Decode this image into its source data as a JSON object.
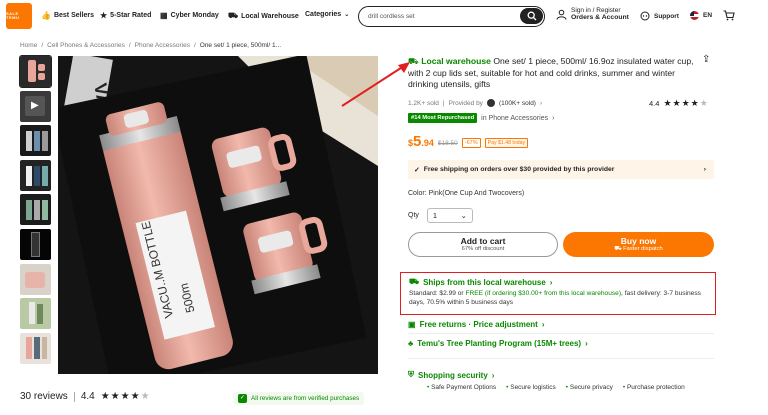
{
  "header": {
    "logo_line1": "SALE TEMU",
    "logo_line2": "TEMU",
    "nav": [
      {
        "label": "Best Sellers",
        "icon": "thumbs-up-icon"
      },
      {
        "label": "5-Star Rated",
        "icon": "star-icon"
      },
      {
        "label": "Cyber Monday",
        "icon": "calendar-icon"
      },
      {
        "label": "Local Warehouse",
        "icon": "truck-icon"
      },
      {
        "label": "Categories",
        "icon": "chevron-down-icon"
      }
    ],
    "search_value": "drill cordless set",
    "signin_line1": "Sign in / Register",
    "signin_line2": "Orders & Account",
    "support": "Support",
    "language": "EN"
  },
  "breadcrumb": [
    "Home",
    "Cell Phones & Accessories",
    "Phone Accessories",
    "One set/ 1 piece, 500ml/ 1..."
  ],
  "gallery": {
    "reviews": "30 reviews",
    "rating": "4.4",
    "verified": "All reviews are from verified purchases"
  },
  "product": {
    "local_warehouse": "Local warehouse",
    "title": "One set/ 1 piece, 500ml/ 16.9oz insulated water cup, with 2 cup lids set, suitable for hot and cold drinks, summer and winter drinking utensils, gifts",
    "sold": "1.2K+ sold",
    "provided_by": "Provided by",
    "store_sold": "(100K+ sold)",
    "rating": "4.4",
    "rank_tag": "#14 Most Repurchased",
    "rank_cat": "in Phone Accessories",
    "price_dollar": "$",
    "price_main": "5",
    "price_cents": ".94",
    "price_orig": "$18.50",
    "discount": "-67%",
    "pay_tag": "Pay $1.48 today",
    "free_shipping": "Free shipping on orders over $30 provided by this provider",
    "color": "Color: Pink(One Cup And Twocovers)",
    "qty_label": "Qty",
    "qty_value": "1",
    "add_to_cart": "Add to cart",
    "add_to_cart_sub": "67% off discount",
    "buy_now": "Buy now",
    "buy_now_sub": "Faster dispatch",
    "ships_title": "Ships from this local warehouse",
    "ships_std": "Standard: $2.99 or",
    "ships_free": "FREE (if ordering $30.00+ from this local warehouse)",
    "ships_rest": ", fast delivery: 3-7 business days, 70.5% within 5 business days",
    "free_returns": "Free returns · Price adjustment",
    "tree": "Temu's Tree Planting Program (15M+ trees)",
    "security": "Shopping security",
    "security_items": [
      "Safe Payment Options",
      "Secure logistics",
      "Secure privacy",
      "Purchase protection"
    ]
  }
}
